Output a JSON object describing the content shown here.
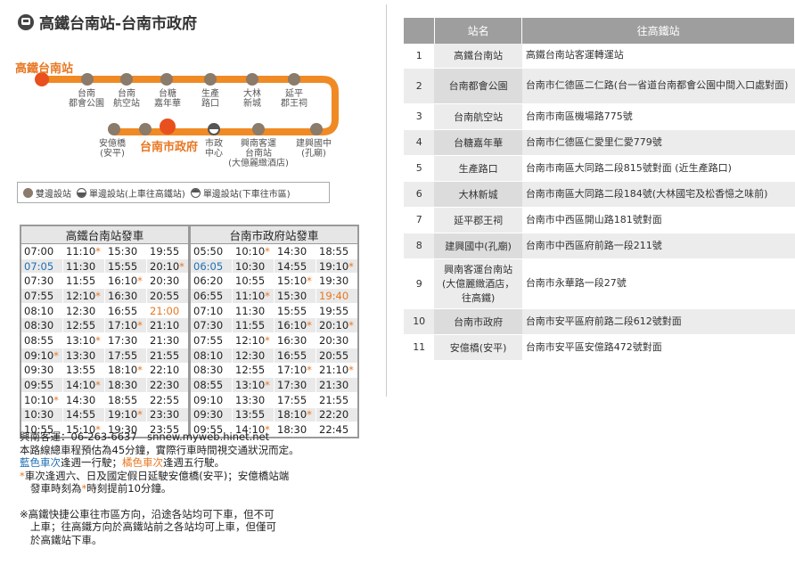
{
  "header": {
    "title": "高鐵台南站-台南市政府",
    "icon": "bus-icon"
  },
  "route_map": {
    "start_label": "高鐵台南站",
    "current_label": "台南市政府",
    "top_stops": [
      [
        "台南",
        "都會公園"
      ],
      [
        "台南",
        "航空站"
      ],
      [
        "台糖",
        "嘉年華"
      ],
      [
        "生產",
        "路口"
      ],
      [
        "大林",
        "新城"
      ],
      [
        "延平",
        "郡王祠"
      ]
    ],
    "bottom_stops": [
      [
        "安億橋",
        "(安平)"
      ],
      [
        "市政",
        "中心"
      ],
      [
        "興南客運",
        "台南站",
        "(大億麗緻酒店)"
      ],
      [
        "建興國中",
        "(孔廟)"
      ]
    ],
    "colors": {
      "route": "#f08a24",
      "stop": "#8a7b6a",
      "current": "#e8501e"
    }
  },
  "legend": {
    "both": "雙邊設站",
    "up_only": "單邊設站(上車往高鐵站)",
    "down_only": "單邊設站(下車往市區)"
  },
  "timetable": {
    "headers": [
      "高鐵台南站發車",
      "台南市政府站發車"
    ],
    "rows": [
      [
        "07:00",
        "11:10*",
        "15:30",
        "19:55",
        "05:50",
        "10:10*",
        "14:30",
        "18:55"
      ],
      [
        "07:05",
        "11:30",
        "15:55",
        "20:10*",
        "06:05",
        "10:30",
        "14:55",
        "19:10*"
      ],
      [
        "07:30",
        "11:55",
        "16:10*",
        "20:30",
        "06:20",
        "10:55",
        "15:10*",
        "19:30"
      ],
      [
        "07:55",
        "12:10*",
        "16:30",
        "20:55",
        "06:55",
        "11:10*",
        "15:30",
        "19:40"
      ],
      [
        "08:10",
        "12:30",
        "16:55",
        "21:00",
        "07:10",
        "11:30",
        "15:55",
        "19:55"
      ],
      [
        "08:30",
        "12:55",
        "17:10*",
        "21:10",
        "07:30",
        "11:55",
        "16:10*",
        "20:10*"
      ],
      [
        "08:55",
        "13:10*",
        "17:30",
        "21:30",
        "07:55",
        "12:10*",
        "16:30",
        "20:30"
      ],
      [
        "09:10*",
        "13:30",
        "17:55",
        "21:55",
        "08:10",
        "12:30",
        "16:55",
        "20:55"
      ],
      [
        "09:30",
        "13:55",
        "18:10*",
        "22:10",
        "08:30",
        "12:55",
        "17:10*",
        "21:10*"
      ],
      [
        "09:55",
        "14:10*",
        "18:30",
        "22:30",
        "08:55",
        "13:10*",
        "17:30",
        "21:30"
      ],
      [
        "10:10*",
        "14:30",
        "18:55",
        "22:55",
        "09:10",
        "13:30",
        "17:55",
        "21:55"
      ],
      [
        "10:30",
        "14:55",
        "19:10*",
        "23:30",
        "09:30",
        "13:55",
        "18:10*",
        "22:20"
      ],
      [
        "10:55",
        "15:10*",
        "19:30",
        "23:55",
        "09:55",
        "14:10*",
        "18:30",
        "22:45"
      ]
    ],
    "blue_cells": [
      [
        1,
        0
      ],
      [
        1,
        4
      ]
    ],
    "orange_cells": [
      [
        4,
        3
      ],
      [
        3,
        7
      ]
    ],
    "colors": {
      "blue": "#1f6fb3",
      "orange": "#e87722"
    }
  },
  "notes": {
    "contact": "興南客運：06-263-6637　snnew.myweb.hinet.net",
    "duration": "本路線總車程預估為45分鐘，實際行車時間視交通狀況而定。",
    "blue_label": "藍色車次",
    "blue_text": "逢週一行駛；",
    "orange_label": "橘色車次",
    "orange_text": "逢週五行駛。",
    "star_prefix": "*",
    "star_line1": "車次逢週六、日及國定假日延駛安億橋(安平)；安億橋站端",
    "star_line2a": "發車時刻為",
    "star_line2b": "*",
    "star_line2c": "時刻提前10分鐘。",
    "remark_line1": "※高鐵快捷公車往市區方向，沿途各站均可下車，但不可",
    "remark_line2": "上車；往高鐵方向於高鐵站前之各站均可上車，但僅可",
    "remark_line3": "於高鐵站下車。"
  },
  "stations_table": {
    "headers": [
      "站名",
      "往高鐵站"
    ],
    "rows": [
      {
        "no": "1",
        "name": "高鐵台南站",
        "addr": "高鐵台南站客運轉運站"
      },
      {
        "no": "2",
        "name": "台南都會公園",
        "addr": "台南市仁德區二仁路(台一省道台南都會公園中間入口處對面)"
      },
      {
        "no": "3",
        "name": "台南航空站",
        "addr": "台南市南區機場路775號"
      },
      {
        "no": "4",
        "name": "台糖嘉年華",
        "addr": "台南市仁德區仁愛里仁愛779號"
      },
      {
        "no": "5",
        "name": "生產路口",
        "addr": "台南市南區大同路二段815號對面 (近生產路口)"
      },
      {
        "no": "6",
        "name": "大林新城",
        "addr": "台南市南區大同路二段184號(大林國宅及松香憶之味前)"
      },
      {
        "no": "7",
        "name": "延平郡王祠",
        "addr": "台南市中西區開山路181號對面"
      },
      {
        "no": "8",
        "name": "建興國中(孔廟)",
        "addr": "台南市中西區府前路一段211號"
      },
      {
        "no": "9",
        "name": "興南客運台南站(大億麗緻酒店，往高鐵)",
        "addr": "台南市永華路一段27號"
      },
      {
        "no": "10",
        "name": "台南市政府",
        "addr": "台南市安平區府前路二段612號對面"
      },
      {
        "no": "11",
        "name": "安億橋(安平)",
        "addr": "台南市安平區安億路472號對面"
      }
    ]
  }
}
